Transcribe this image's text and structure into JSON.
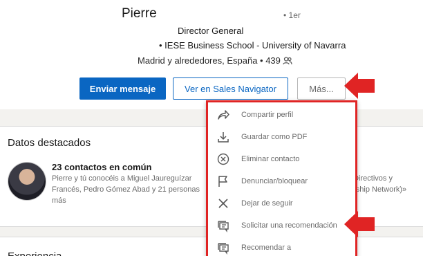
{
  "profile": {
    "name": "Pierre",
    "degree": "• 1er",
    "headline": "Director General",
    "school": "• IESE Business School - University of Navarra",
    "location": "Madrid y alrededores, España • 439"
  },
  "actions": {
    "message": "Enviar mensaje",
    "sales_navigator": "Ver en Sales Navigator",
    "more": "Más..."
  },
  "highlights": {
    "title": "Datos destacados",
    "contacts_title": "23 contactos en común",
    "contacts_desc": "Pierre y tú conocéis a Miguel Jaureguízar Francés, Pedro Gómez Abad y 21 personas más",
    "right_line1": "«Directivos y",
    "right_line2": "ership Network)»"
  },
  "bottom": {
    "title": "Experiencia"
  },
  "menu": {
    "items": [
      {
        "label": "Compartir perfil",
        "icon": "share-icon"
      },
      {
        "label": "Guardar como PDF",
        "icon": "download-icon"
      },
      {
        "label": "Eliminar contacto",
        "icon": "remove-circle-icon"
      },
      {
        "label": "Denunciar/bloquear",
        "icon": "flag-icon"
      },
      {
        "label": "Dejar de seguir",
        "icon": "close-icon"
      },
      {
        "label": "Solicitar una recomendación",
        "icon": "recommendation-icon"
      },
      {
        "label": "Recomendar a",
        "icon": "recommend-icon"
      }
    ]
  },
  "colors": {
    "primary": "#0a66c2",
    "annotation_red": "#e02424"
  }
}
